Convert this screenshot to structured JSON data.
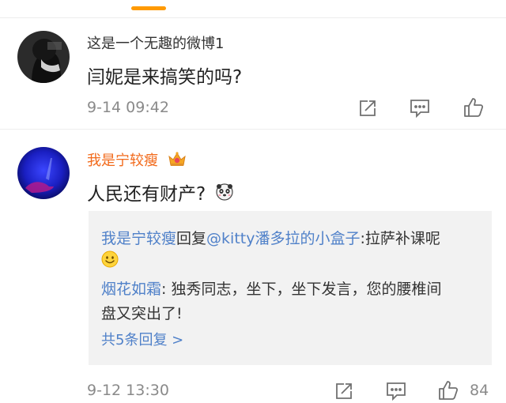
{
  "colors": {
    "accent": "#ff9a00",
    "username_vip": "#f26a1b",
    "link": "#5081c9",
    "meta": "#8a8a8a"
  },
  "comments": [
    {
      "username": "这是一个无趣的微博1",
      "text": "闫妮是来搞笑的吗?",
      "time": "9-14 09:42"
    },
    {
      "username": "我是宁较瘦",
      "badge_icon": "crown-icon",
      "text": "人民还有财产?",
      "emoji_icon": "panda-emoji-icon",
      "time": "9-12 13:30",
      "like_count": "84",
      "replies": [
        {
          "user": "我是宁较瘦",
          "verb": "回复",
          "mention": "@kitty潘多拉的小盒子",
          "text": ":拉萨补课呢",
          "emoji_icon": "smile-emoji-icon"
        },
        {
          "user": "烟花如霜",
          "text_line1": ": 独秀同志，坐下，坐下发言，您的腰椎间",
          "text_line2": "盘又突出了!"
        }
      ],
      "more_replies": "共5条回复 >"
    }
  ]
}
